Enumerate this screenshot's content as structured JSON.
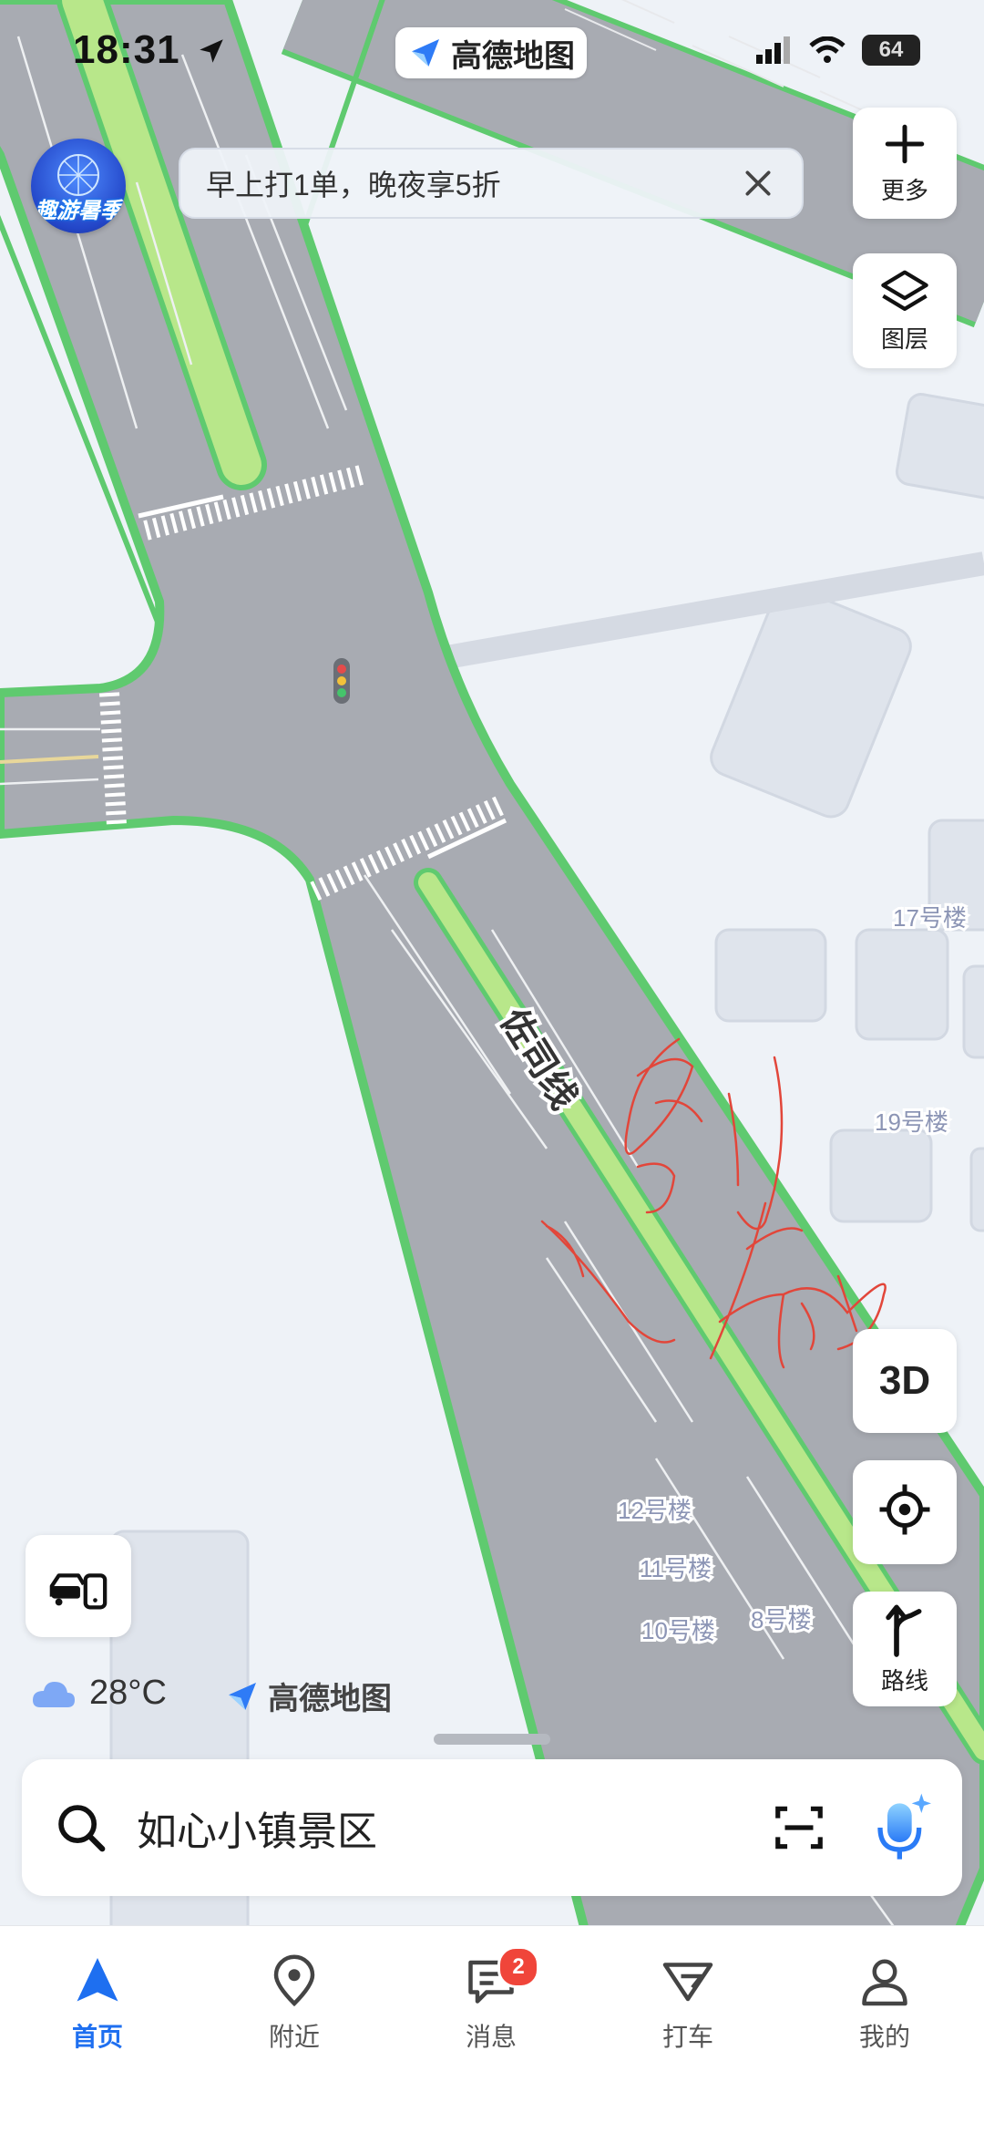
{
  "status_bar": {
    "time": "18:31",
    "battery": "64"
  },
  "app_pill": {
    "label": "高德地图"
  },
  "promo": {
    "text": "早上打1单，晚夜享5折"
  },
  "avatar": {
    "label": "趣游暑季"
  },
  "side_buttons": {
    "more": "更多",
    "layers": "图层",
    "three_d": "3D",
    "route": "路线"
  },
  "map": {
    "road_label": "佐司线",
    "buildings": [
      "17号楼",
      "19号楼",
      "12号楼",
      "11号楼",
      "10号楼",
      "8号楼"
    ],
    "handwriting": "别闹"
  },
  "weather": {
    "temp": "28°C"
  },
  "map_logo": {
    "label": "高德地图"
  },
  "search": {
    "value": "如心小镇景区"
  },
  "tabs": [
    {
      "label": "首页",
      "icon": "home-arrow-icon",
      "active": true
    },
    {
      "label": "附近",
      "icon": "location-pin-icon",
      "active": false
    },
    {
      "label": "消息",
      "icon": "message-icon",
      "active": false,
      "badge": "2"
    },
    {
      "label": "打车",
      "icon": "taxi-icon",
      "active": false
    },
    {
      "label": "我的",
      "icon": "profile-icon",
      "active": false
    }
  ],
  "colors": {
    "accent": "#1e6ff0",
    "road_border": "#5fca6f",
    "road": "#a8abb2",
    "median": "#b8e78a",
    "badge": "#f0453a",
    "map_bg": "#eef2f7"
  }
}
